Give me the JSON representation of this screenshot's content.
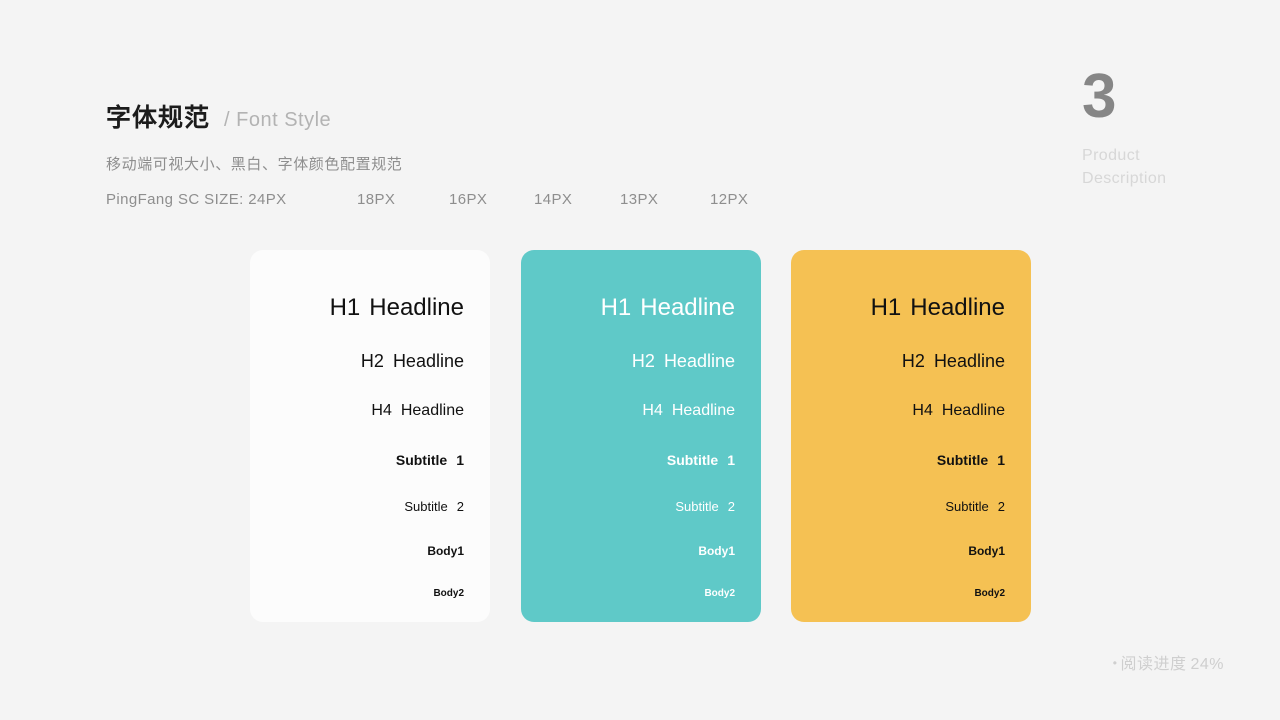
{
  "header": {
    "title_cn": "字体规范",
    "title_en": "/ Font Style",
    "subtitle_cn": "移动端可视大小、黑白、字体颜色配置规范",
    "size_scale_label": "PingFang SC SIZE: 24PX",
    "sizes": [
      "18PX",
      "16PX",
      "14PX",
      "13PX",
      "12PX"
    ]
  },
  "section": {
    "number": "3",
    "caption_line1": "Product",
    "caption_line2": "Description"
  },
  "cards": [
    {
      "name": "white-card",
      "background": "#fcfcfc",
      "text_color": "#111111",
      "rows": [
        {
          "label": "H1",
          "text": "Headline"
        },
        {
          "label": "H2",
          "text": "Headline"
        },
        {
          "label": "H4",
          "text": "Headline"
        },
        {
          "label": "Subtitle",
          "text": "1"
        },
        {
          "label": "Subtitle",
          "text": "2"
        },
        {
          "label": "Body1",
          "text": ""
        },
        {
          "label": "Body2",
          "text": ""
        }
      ]
    },
    {
      "name": "teal-card",
      "background": "#5fc9c8",
      "text_color": "#ffffff",
      "rows": [
        {
          "label": "H1",
          "text": "Headline"
        },
        {
          "label": "H2",
          "text": "Headline"
        },
        {
          "label": "H4",
          "text": "Headline"
        },
        {
          "label": "Subtitle",
          "text": "1"
        },
        {
          "label": "Subtitle",
          "text": "2"
        },
        {
          "label": "Body1",
          "text": ""
        },
        {
          "label": "Body2",
          "text": ""
        }
      ]
    },
    {
      "name": "yellow-card",
      "background": "#f5c153",
      "text_color": "#111111",
      "rows": [
        {
          "label": "H1",
          "text": "Headline"
        },
        {
          "label": "H2",
          "text": "Headline"
        },
        {
          "label": "H4",
          "text": "Headline"
        },
        {
          "label": "Subtitle",
          "text": "1"
        },
        {
          "label": "Subtitle",
          "text": "2"
        },
        {
          "label": "Body1",
          "text": ""
        },
        {
          "label": "Body2",
          "text": ""
        }
      ]
    }
  ],
  "footer": {
    "bullet": "•",
    "progress_label": "阅读进度",
    "progress_value": "24%"
  },
  "colors": {
    "page_background": "#f4f4f4",
    "teal": "#5fc9c8",
    "yellow": "#f5c153",
    "white_card": "#fcfcfc",
    "heading_text": "#1b1b1b",
    "muted_text": "#8e8e8e",
    "faint_text": "#d7d7d7"
  }
}
